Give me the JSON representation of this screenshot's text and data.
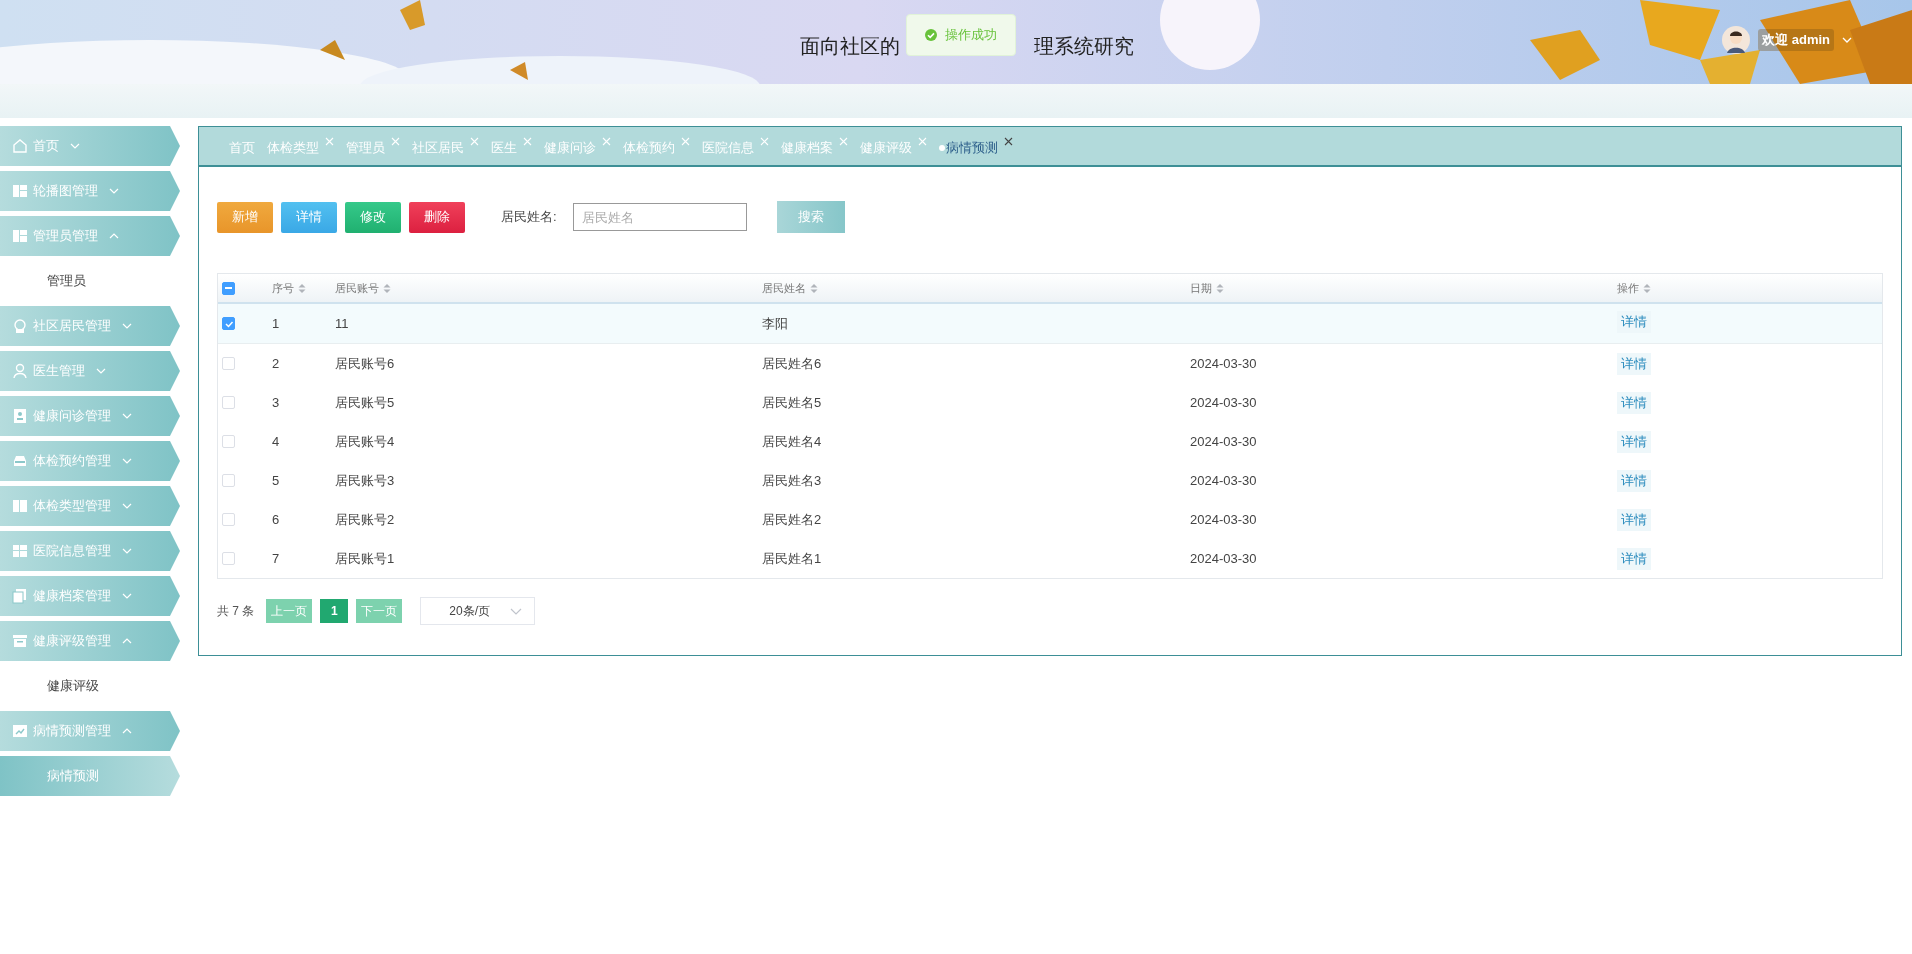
{
  "header": {
    "title_start": "面向社区的",
    "title_end": "理系统研究",
    "user_label": "欢迎 admin"
  },
  "toast": {
    "message": "操作成功"
  },
  "sidebar": {
    "items": [
      {
        "label": "首页",
        "expanded": false
      },
      {
        "label": "轮播图管理",
        "expanded": false
      },
      {
        "label": "管理员管理",
        "expanded": true,
        "children": [
          {
            "label": "管理员",
            "selected": false
          }
        ]
      },
      {
        "label": "社区居民管理",
        "expanded": false
      },
      {
        "label": "医生管理",
        "expanded": false
      },
      {
        "label": "健康问诊管理",
        "expanded": false
      },
      {
        "label": "体检预约管理",
        "expanded": false
      },
      {
        "label": "体检类型管理",
        "expanded": false
      },
      {
        "label": "医院信息管理",
        "expanded": false
      },
      {
        "label": "健康档案管理",
        "expanded": false
      },
      {
        "label": "健康评级管理",
        "expanded": true,
        "children": [
          {
            "label": "健康评级",
            "selected": false
          }
        ]
      },
      {
        "label": "病情预测管理",
        "expanded": true,
        "children": [
          {
            "label": "病情预测",
            "selected": true
          }
        ]
      }
    ]
  },
  "tabs": [
    {
      "label": "首页",
      "closable": false,
      "selected": false
    },
    {
      "label": "体检类型",
      "closable": true,
      "selected": false
    },
    {
      "label": "管理员",
      "closable": true,
      "selected": false
    },
    {
      "label": "社区居民",
      "closable": true,
      "selected": false
    },
    {
      "label": "医生",
      "closable": true,
      "selected": false
    },
    {
      "label": "健康问诊",
      "closable": true,
      "selected": false
    },
    {
      "label": "体检预约",
      "closable": true,
      "selected": false
    },
    {
      "label": "医院信息",
      "closable": true,
      "selected": false
    },
    {
      "label": "健康档案",
      "closable": true,
      "selected": false
    },
    {
      "label": "健康评级",
      "closable": true,
      "selected": false
    },
    {
      "label": "病情预测",
      "closable": true,
      "selected": true
    }
  ],
  "toolbar": {
    "buttons": [
      {
        "label": "新增",
        "kind": "add"
      },
      {
        "label": "详情",
        "kind": "detail"
      },
      {
        "label": "修改",
        "kind": "edit"
      },
      {
        "label": "删除",
        "kind": "delete"
      }
    ],
    "search": {
      "label": "居民姓名:",
      "placeholder": "居民姓名",
      "button": "搜索"
    }
  },
  "table": {
    "select_all": {
      "indeterminate": true
    },
    "columns": [
      "序号",
      "居民账号",
      "居民姓名",
      "日期",
      "操作"
    ],
    "rows": [
      {
        "selected": true,
        "cells": [
          "1",
          "11",
          "李阳",
          ""
        ],
        "action": "详情"
      },
      {
        "selected": false,
        "cells": [
          "2",
          "居民账号6",
          "居民姓名6",
          "2024-03-30"
        ],
        "action": "详情"
      },
      {
        "selected": false,
        "cells": [
          "3",
          "居民账号5",
          "居民姓名5",
          "2024-03-30"
        ],
        "action": "详情"
      },
      {
        "selected": false,
        "cells": [
          "4",
          "居民账号4",
          "居民姓名4",
          "2024-03-30"
        ],
        "action": "详情"
      },
      {
        "selected": false,
        "cells": [
          "5",
          "居民账号3",
          "居民姓名3",
          "2024-03-30"
        ],
        "action": "详情"
      },
      {
        "selected": false,
        "cells": [
          "6",
          "居民账号2",
          "居民姓名2",
          "2024-03-30"
        ],
        "action": "详情"
      },
      {
        "selected": false,
        "cells": [
          "7",
          "居民账号1",
          "居民姓名1",
          "2024-03-30"
        ],
        "action": "详情"
      }
    ]
  },
  "pagination": {
    "total": "共 7 条",
    "prev": "上一页",
    "pages": [
      {
        "label": "1",
        "selected": true
      }
    ],
    "next": "下一页",
    "page_size": "20条/页"
  }
}
